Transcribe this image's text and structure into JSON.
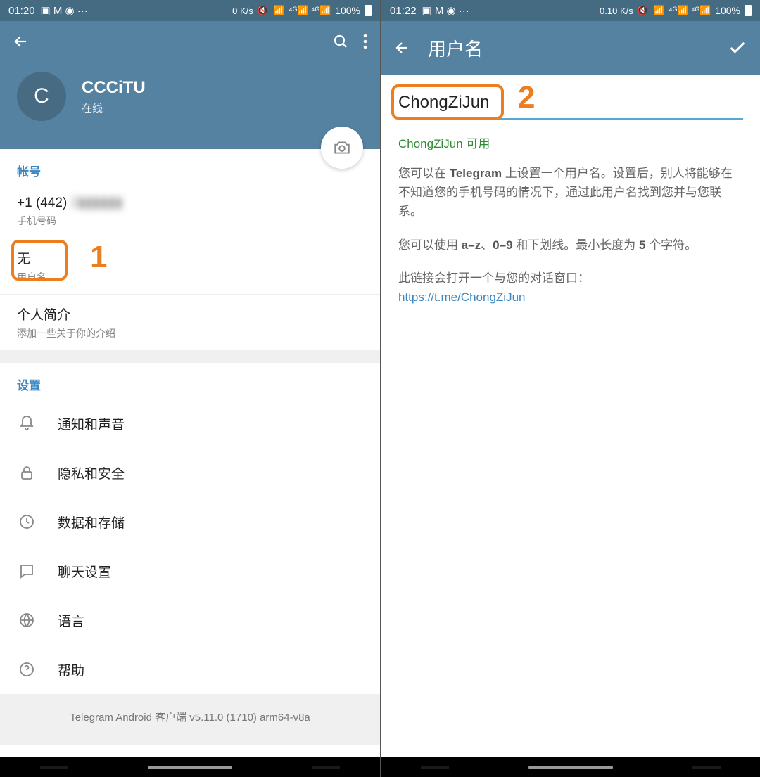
{
  "left": {
    "status": {
      "time": "01:20",
      "net": "0 K/s",
      "battery": "100%"
    },
    "profile": {
      "avatar_letter": "C",
      "name": "CCCiTU",
      "status": "在线"
    },
    "account": {
      "section_title": "帐号",
      "phone_value": "+1 (442)",
      "phone_blur": "2▮▮▮▮▮▮",
      "phone_label": "手机号码",
      "username_value": "无",
      "username_label": "用户名",
      "bio_value": "个人简介",
      "bio_label": "添加一些关于你的介绍"
    },
    "settings": {
      "section_title": "设置",
      "items": [
        {
          "label": "通知和声音",
          "icon": "bell"
        },
        {
          "label": "隐私和安全",
          "icon": "lock"
        },
        {
          "label": "数据和存储",
          "icon": "clock"
        },
        {
          "label": "聊天设置",
          "icon": "chat"
        },
        {
          "label": "语言",
          "icon": "globe"
        },
        {
          "label": "帮助",
          "icon": "help"
        }
      ]
    },
    "footer": "Telegram Android 客户端 v5.11.0 (1710) arm64-v8a",
    "annotation": "1"
  },
  "right": {
    "status": {
      "time": "01:22",
      "net": "0.10 K/s",
      "battery": "100%"
    },
    "toolbar_title": "用户名",
    "input_value": "ChongZiJun",
    "available_text": "ChongZiJun 可用",
    "help1_pre": "您可以在 ",
    "help1_b1": "Telegram",
    "help1_post": " 上设置一个用户名。设置后，别人将能够在不知道您的手机号码的情况下，通过此用户名找到您并与您联系。",
    "help2_pre": "您可以使用 ",
    "help2_b1": "a–z",
    "help2_mid1": "、",
    "help2_b2": "0–9",
    "help2_mid2": " 和下划线。最小长度为 ",
    "help2_b3": "5",
    "help2_post": " 个字符。",
    "help3": "此链接会打开一个与您的对话窗口：",
    "link": "https://t.me/ChongZiJun",
    "annotation": "2"
  }
}
